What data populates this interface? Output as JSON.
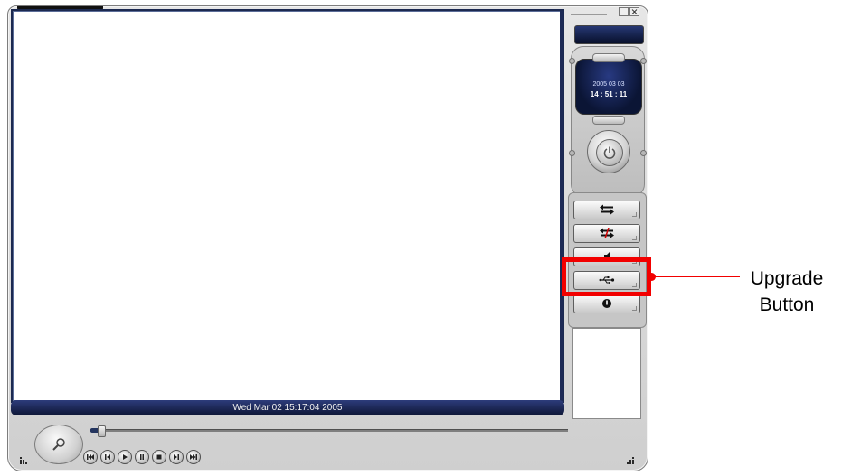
{
  "status_bar": {
    "timestamp": "Wed Mar 02 15:17:04 2005"
  },
  "clock": {
    "date": "2005 03 03",
    "time": "14 : 51 : 11"
  },
  "callout": {
    "label_line1": "Upgrade",
    "label_line2": "Button"
  },
  "side_buttons": [
    "swap-arrows-icon",
    "swap-arrows-disabled-icon",
    "speaker-icon",
    "usb-icon",
    "info-icon"
  ],
  "transport_buttons": [
    "previous-icon",
    "step-back-icon",
    "play-icon",
    "pause-icon",
    "stop-icon",
    "step-forward-icon",
    "next-icon"
  ],
  "colors": {
    "highlight": "#f20000",
    "panel_navy": "#1c2950",
    "status_bg": "#0e1636"
  }
}
